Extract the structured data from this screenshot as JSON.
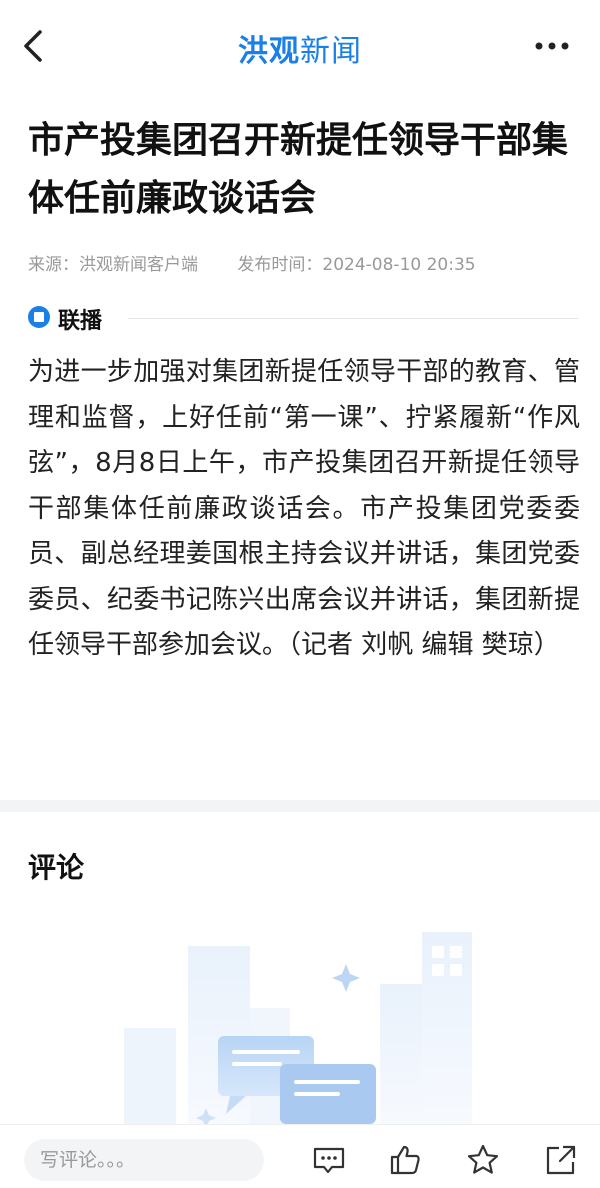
{
  "header": {
    "brand_part1": "洪观",
    "brand_part2": "新闻"
  },
  "article": {
    "title": "市产投集团召开新提任领导干部集体任前廉政谈话会",
    "source": "来源：洪观新闻客户端",
    "published": "发布时间：2024-08-10 20:35",
    "section_label": "联播",
    "body": "为进一步加强对集团新提任领导干部的教育、管理和监督，上好任前“第一课”、拧紧履新“作风弦”，8月8日上午，市产投集团召开新提任领导干部集体任前廉政谈话会。市产投集团党委委员、副总经理姜国根主持会议并讲话，集团党委委员、纪委书记陈兴出席会议并讲话，集团新提任领导干部参加会议。（记者 刘帆 编辑 樊琼）"
  },
  "comments": {
    "title": "评论"
  },
  "bottom_bar": {
    "input_placeholder": "写评论。。。",
    "icons": [
      "comment-icon",
      "like-icon",
      "favorite-icon",
      "share-icon"
    ]
  },
  "colors": {
    "brand": "#1a7fe6",
    "muted": "#999999",
    "separator": "#f3f4f6"
  }
}
